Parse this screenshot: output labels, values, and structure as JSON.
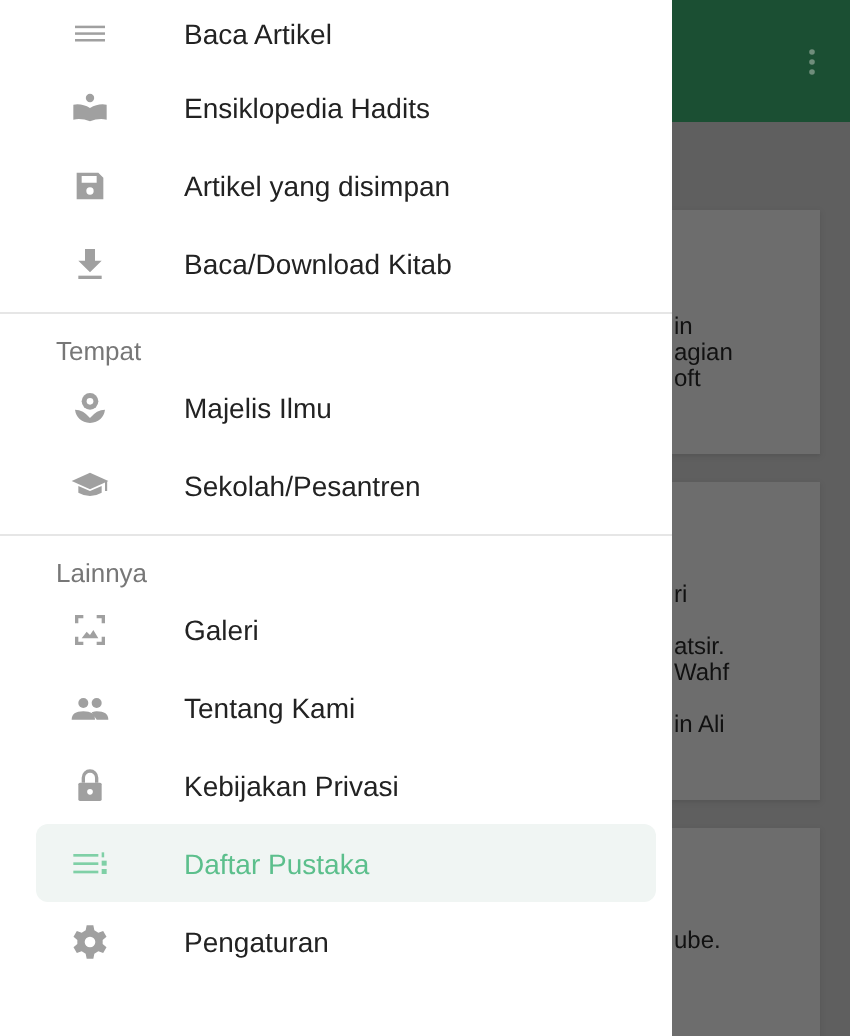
{
  "drawer": {
    "sections": [
      {
        "items": [
          {
            "label": "Baca Artikel",
            "selected": false
          },
          {
            "label": "Ensiklopedia Hadits",
            "selected": false
          },
          {
            "label": "Artikel yang disimpan",
            "selected": false
          },
          {
            "label": "Baca/Download Kitab",
            "selected": false
          }
        ]
      },
      {
        "header": "Tempat",
        "items": [
          {
            "label": "Majelis Ilmu",
            "selected": false
          },
          {
            "label": "Sekolah/Pesantren",
            "selected": false
          }
        ]
      },
      {
        "header": "Lainnya",
        "items": [
          {
            "label": "Galeri",
            "selected": false
          },
          {
            "label": "Tentang Kami",
            "selected": false
          },
          {
            "label": "Kebijakan Privasi",
            "selected": false
          },
          {
            "label": "Daftar Pustaka",
            "selected": true
          },
          {
            "label": "Pengaturan",
            "selected": false
          }
        ]
      }
    ]
  },
  "background_cards": [
    {
      "paragraphs": [
        [
          "in",
          "agian",
          "oft"
        ]
      ]
    },
    {
      "paragraphs": [
        [
          "ri"
        ],
        [
          "atsir.",
          "Wahf"
        ],
        [
          "in Ali"
        ]
      ]
    },
    {
      "paragraphs": [
        [
          "ube."
        ]
      ]
    }
  ]
}
